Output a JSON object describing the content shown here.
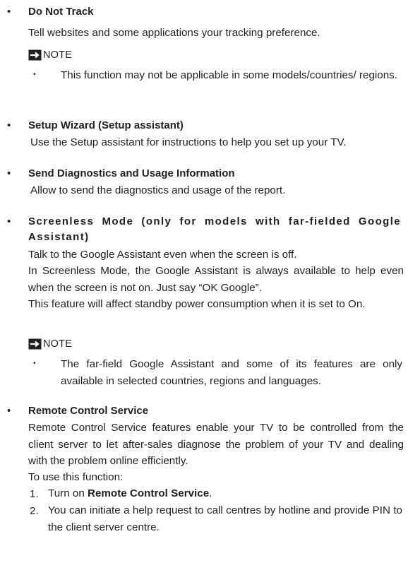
{
  "sections": [
    {
      "heading": "Do Not Track",
      "body": "Tell websites and some applications your tracking preference.",
      "note": {
        "label": "NOTE",
        "items": [
          "This function may not be applicable in some models/countries/ regions."
        ]
      }
    },
    {
      "heading": "Setup Wizard (Setup assistant)",
      "body": "Use the Setup assistant for instructions to help you set up your TV."
    },
    {
      "heading": "Send Diagnostics and Usage Information",
      "body": "Allow to send the diagnostics and usage of the report."
    },
    {
      "heading": "Screenless Mode (only for models with far-fielded Google Assistant)",
      "body_lines": [
        "Talk to the Google Assistant even when the screen is off.",
        "In Screenless Mode, the Google Assistant is always available to help even when the screen is not on. Just say “OK Google”.",
        "This feature will affect standby power consumption when it is set to On."
      ],
      "note": {
        "label": "NOTE",
        "items": [
          "The far-field Google Assistant and some of its features are only available in selected countries, regions and languages."
        ]
      }
    },
    {
      "heading": "Remote Control Service",
      "body": "Remote Control Service features enable your TV to be controlled from the client server to let after-sales diagnose the problem of your TV and dealing with the problem online efficiently.",
      "intro": "To use this function:",
      "steps": [
        {
          "num": "1.",
          "before": "Turn on ",
          "bold": "Remote Control Service",
          "after": "."
        },
        {
          "num": "2.",
          "text": "You can initiate a help request to call centres by hotline and provide PIN to the client server centre."
        }
      ]
    }
  ],
  "bullet_char": "•",
  "sub_bullet_char": "•"
}
